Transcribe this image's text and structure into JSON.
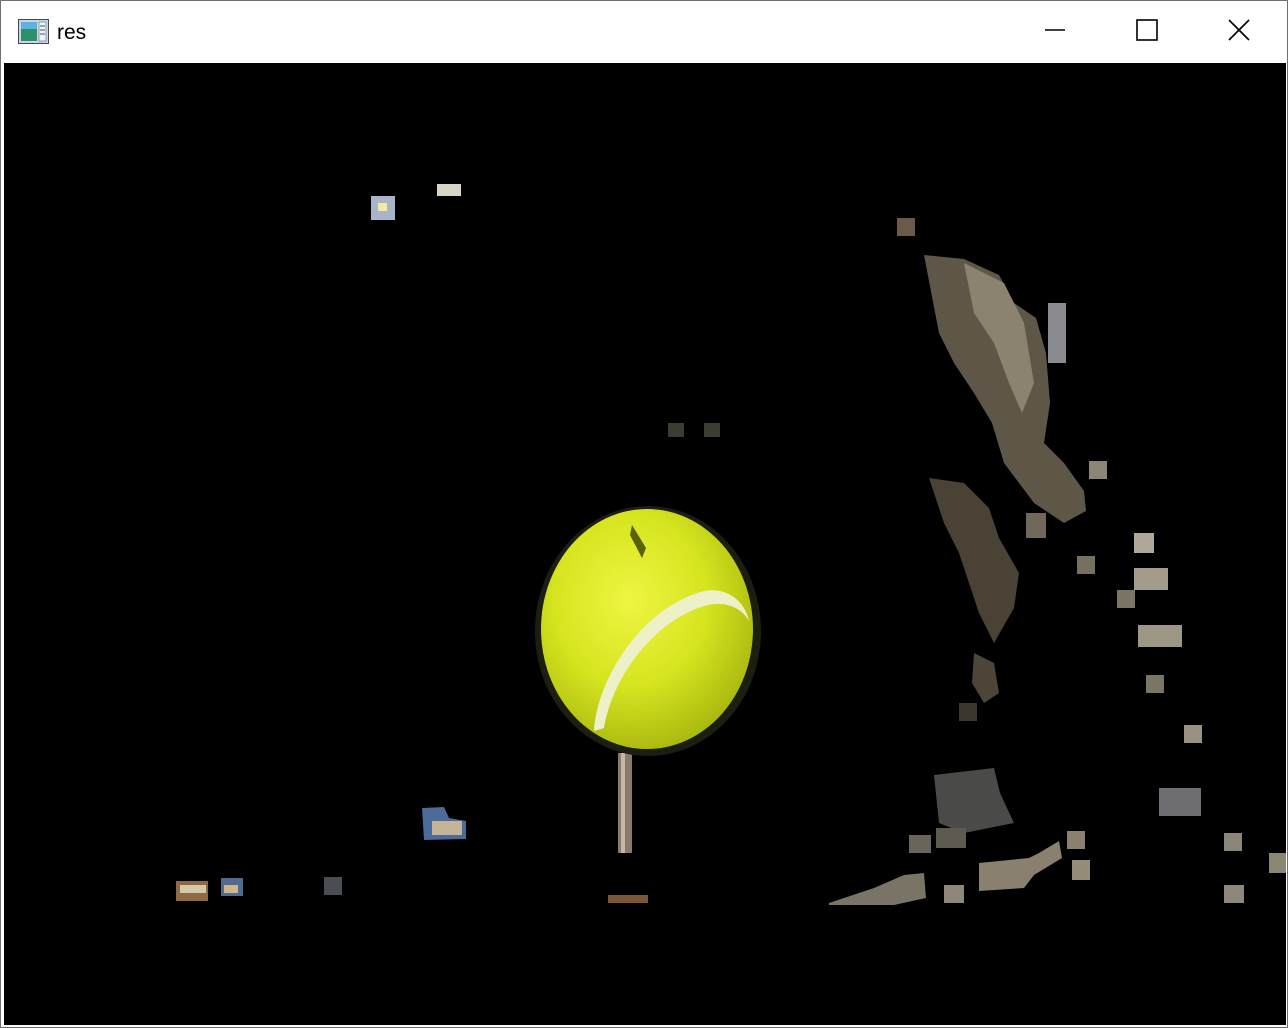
{
  "window": {
    "title": "res",
    "app_icon": "opencv-image-window-icon",
    "controls": {
      "minimize_icon": "minimize-icon",
      "maximize_icon": "maximize-icon",
      "close_icon": "close-icon"
    }
  },
  "image": {
    "description_icon": "segmented-image",
    "colors": {
      "background": "#000000",
      "ball": "#d4e51d",
      "ball_seam": "#eef0c8",
      "fragments": "#6f6a5e"
    }
  }
}
